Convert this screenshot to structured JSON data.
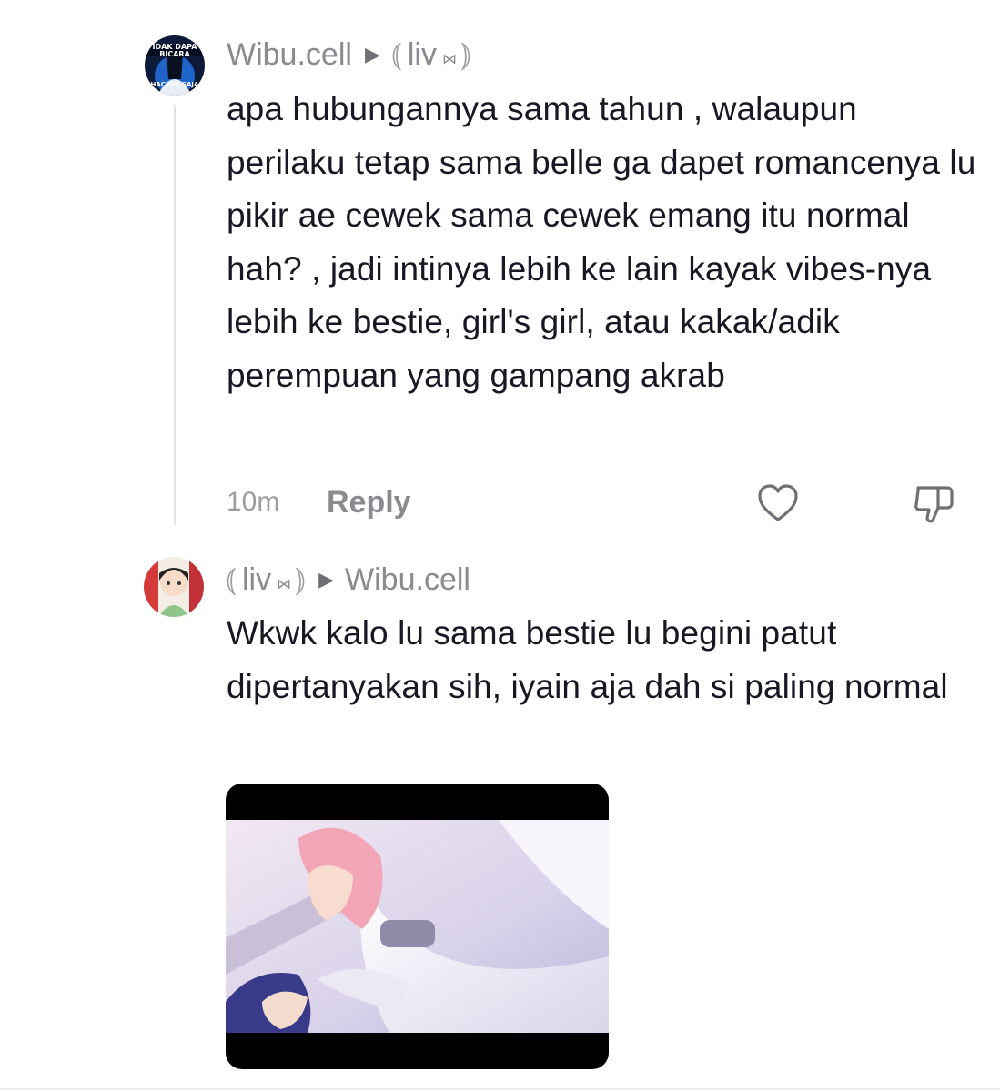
{
  "comments": [
    {
      "author": "Wibu.cell",
      "reply_to": "liv",
      "text": "apa hubungannya sama tahun , walaupun perilaku tetap sama belle ga dapet romancenya lu pikir ae cewek sama cewek emang itu normal hah? , jadi intinya lebih ke lain kayak vibes-nya lebih ke bestie, girl's girl, atau kakak/adik perempuan yang gampang akrab",
      "time": "10m",
      "reply_label": "Reply",
      "avatar_text": [
        "IDAK DAPA",
        "BICARA",
        "HACKER SAJA"
      ]
    },
    {
      "author": "liv",
      "reply_to": "Wibu.cell",
      "text": "Wkwk kalo lu sama bestie lu begini patut dipertanyakan sih, iyain aja dah si paling normal"
    }
  ],
  "icons": {
    "reply_arrow": "triangle-right-icon",
    "like": "heart-outline-icon",
    "dislike": "thumbs-down-outline-icon"
  },
  "colors": {
    "text": "#161823",
    "secondary": "#8a8b91"
  }
}
